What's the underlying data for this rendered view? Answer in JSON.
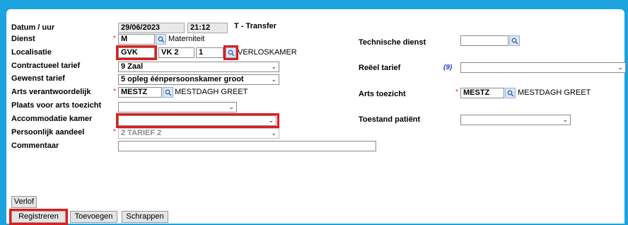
{
  "form": {
    "datum": {
      "label": "Datum / uur",
      "date": "29/06/2023",
      "time": "21:12",
      "type": "T - Transfer"
    },
    "dienst": {
      "label": "Dienst",
      "code": "M",
      "name": "Materniteit"
    },
    "localisatie": {
      "label": "Localisatie",
      "code": "GVK",
      "room": "VK 2",
      "bed": "1",
      "name": "VERLOSKAMER"
    },
    "contractueel_tarief": {
      "label": "Contractueel tarief",
      "value": "9 Zaal"
    },
    "gewenst_tarief": {
      "label": "Gewenst tarief",
      "value": "5 opleg éénpersoonskamer groot"
    },
    "arts_verantwoordelijk": {
      "label": "Arts verantwoordelijk",
      "code": "MESTZ",
      "name": "MESTDAGH GREET"
    },
    "plaats_arts_toezicht": {
      "label": "Plaats voor arts toezicht",
      "value": ""
    },
    "accommodatie_kamer": {
      "label": "Accommodatie kamer",
      "value": ""
    },
    "persoonlijk_aandeel": {
      "label": "Persoonlijk aandeel",
      "value": "2 TARIEF 2"
    },
    "commentaar": {
      "label": "Commentaar",
      "value": ""
    },
    "technische_dienst": {
      "label": "Technische dienst",
      "value": ""
    },
    "reeel_tarief": {
      "label": "Reëel tarief",
      "count": "(9)",
      "value": ""
    },
    "arts_toezicht": {
      "label": "Arts toezicht",
      "code": "MESTZ",
      "name": "MESTDAGH GREET"
    },
    "toestand_patient": {
      "label": "Toestand patiënt",
      "value": ""
    }
  },
  "required_marker": "*",
  "buttons": {
    "verlof": "Verlof",
    "registreren": "Registreren",
    "toevoegen": "Toevoegen",
    "schrappen": "Schrappen"
  },
  "colors": {
    "frame": "#1aa3df",
    "highlight": "#e21b1b",
    "required": "#e0281f",
    "count": "#2b36c9"
  }
}
